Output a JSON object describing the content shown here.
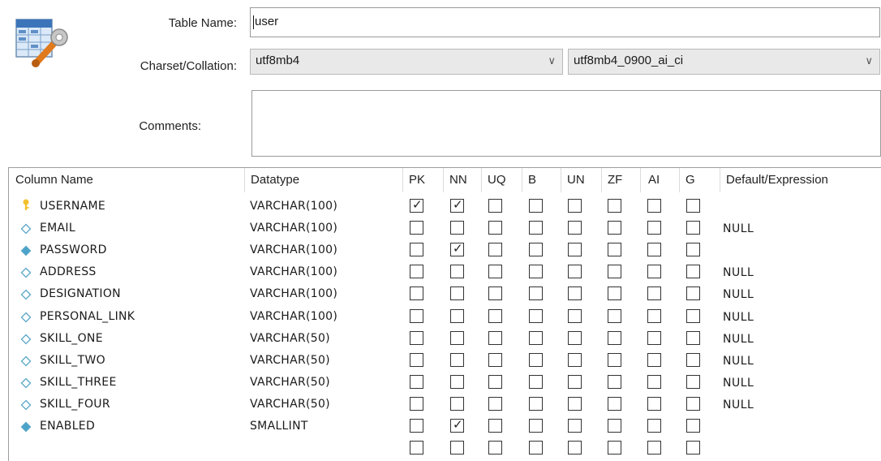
{
  "form": {
    "table_name_label": "Table Name:",
    "table_name_value": "user",
    "charset_label": "Charset/Collation:",
    "charset_value": "utf8mb4",
    "collation_value": "utf8mb4_0900_ai_ci",
    "comments_label": "Comments:",
    "comments_value": ""
  },
  "icons": {
    "table": "table-edit-icon",
    "dropdown": "chevron-down-icon",
    "primary_key": "key-icon",
    "column": "diamond-icon"
  },
  "grid": {
    "headers": [
      "Column Name",
      "Datatype",
      "PK",
      "NN",
      "UQ",
      "B",
      "UN",
      "ZF",
      "AI",
      "G",
      "Default/Expression"
    ],
    "rows": [
      {
        "name": "USERNAME",
        "type": "VARCHAR(100)",
        "icon": "key",
        "flags": [
          true,
          true,
          false,
          false,
          false,
          false,
          false,
          false
        ],
        "default": ""
      },
      {
        "name": "EMAIL",
        "type": "VARCHAR(100)",
        "icon": "open",
        "flags": [
          false,
          false,
          false,
          false,
          false,
          false,
          false,
          false
        ],
        "default": "NULL"
      },
      {
        "name": "PASSWORD",
        "type": "VARCHAR(100)",
        "icon": "filled",
        "flags": [
          false,
          true,
          false,
          false,
          false,
          false,
          false,
          false
        ],
        "default": ""
      },
      {
        "name": "ADDRESS",
        "type": "VARCHAR(100)",
        "icon": "open",
        "flags": [
          false,
          false,
          false,
          false,
          false,
          false,
          false,
          false
        ],
        "default": "NULL"
      },
      {
        "name": "DESIGNATION",
        "type": "VARCHAR(100)",
        "icon": "open",
        "flags": [
          false,
          false,
          false,
          false,
          false,
          false,
          false,
          false
        ],
        "default": "NULL"
      },
      {
        "name": "PERSONAL_LINK",
        "type": "VARCHAR(100)",
        "icon": "open",
        "flags": [
          false,
          false,
          false,
          false,
          false,
          false,
          false,
          false
        ],
        "default": "NULL"
      },
      {
        "name": "SKILL_ONE",
        "type": "VARCHAR(50)",
        "icon": "open",
        "flags": [
          false,
          false,
          false,
          false,
          false,
          false,
          false,
          false
        ],
        "default": "NULL"
      },
      {
        "name": "SKILL_TWO",
        "type": "VARCHAR(50)",
        "icon": "open",
        "flags": [
          false,
          false,
          false,
          false,
          false,
          false,
          false,
          false
        ],
        "default": "NULL"
      },
      {
        "name": "SKILL_THREE",
        "type": "VARCHAR(50)",
        "icon": "open",
        "flags": [
          false,
          false,
          false,
          false,
          false,
          false,
          false,
          false
        ],
        "default": "NULL"
      },
      {
        "name": "SKILL_FOUR",
        "type": "VARCHAR(50)",
        "icon": "open",
        "flags": [
          false,
          false,
          false,
          false,
          false,
          false,
          false,
          false
        ],
        "default": "NULL"
      },
      {
        "name": "ENABLED",
        "type": "SMALLINT",
        "icon": "filled",
        "flags": [
          false,
          true,
          false,
          false,
          false,
          false,
          false,
          false
        ],
        "default": ""
      },
      {
        "name": "",
        "type": "",
        "icon": "none",
        "flags": [
          false,
          false,
          false,
          false,
          false,
          false,
          false,
          false
        ],
        "default": ""
      }
    ]
  },
  "colors": {
    "key": "#f2c12e",
    "diamond_outline": "#5aa6c8",
    "diamond_fill": "#4aa3c9",
    "select_bg": "#e9e9e9"
  }
}
